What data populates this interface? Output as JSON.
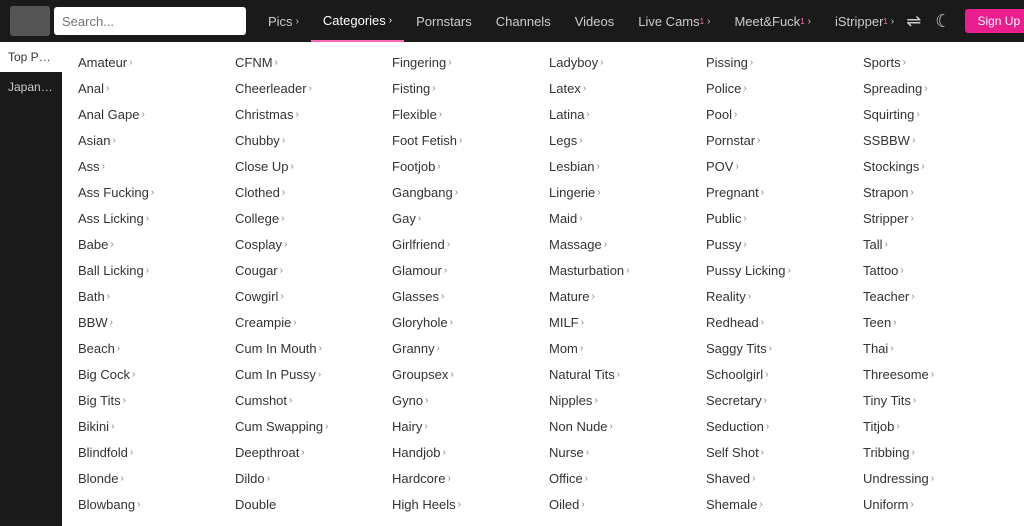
{
  "nav": {
    "items": [
      {
        "label": "Pics",
        "arrow": true,
        "active": false
      },
      {
        "label": "Categories",
        "arrow": true,
        "active": true
      },
      {
        "label": "Pornstars",
        "arrow": false,
        "active": false
      },
      {
        "label": "Channels",
        "arrow": false,
        "active": false
      },
      {
        "label": "Videos",
        "arrow": false,
        "active": false
      },
      {
        "label": "Live Cams",
        "arrow": true,
        "superscript": "1",
        "active": false
      },
      {
        "label": "Meet&Fuck",
        "arrow": true,
        "superscript": "1",
        "active": false
      },
      {
        "label": "iStripper",
        "arrow": true,
        "superscript": "1",
        "active": false
      }
    ],
    "pink_button": "Sign Up"
  },
  "sidebar": {
    "items": [
      {
        "label": "Top Porn"
      },
      {
        "label": "Japanese"
      }
    ]
  },
  "categories": {
    "columns": [
      [
        {
          "label": "Amateur",
          "arrow": true
        },
        {
          "label": "Anal",
          "arrow": true
        },
        {
          "label": "Anal Gape",
          "arrow": true
        },
        {
          "label": "Asian",
          "arrow": true
        },
        {
          "label": "Ass",
          "arrow": true
        },
        {
          "label": "Ass Fucking",
          "arrow": true
        },
        {
          "label": "Ass Licking",
          "arrow": true
        },
        {
          "label": "Babe",
          "arrow": true
        },
        {
          "label": "Ball Licking",
          "arrow": true
        },
        {
          "label": "Bath",
          "arrow": true
        },
        {
          "label": "BBW",
          "arrow": true
        },
        {
          "label": "Beach",
          "arrow": true
        },
        {
          "label": "Big Cock",
          "arrow": true
        },
        {
          "label": "Big Tits",
          "arrow": true
        },
        {
          "label": "Bikini",
          "arrow": true
        },
        {
          "label": "Blindfold",
          "arrow": true
        },
        {
          "label": "Blonde",
          "arrow": true
        },
        {
          "label": "Blowbang",
          "arrow": true
        }
      ],
      [
        {
          "label": "CFNM",
          "arrow": true
        },
        {
          "label": "Cheerleader",
          "arrow": true
        },
        {
          "label": "Christmas",
          "arrow": true
        },
        {
          "label": "Chubby",
          "arrow": true
        },
        {
          "label": "Close Up",
          "arrow": true
        },
        {
          "label": "Clothed",
          "arrow": true
        },
        {
          "label": "College",
          "arrow": true
        },
        {
          "label": "Cosplay",
          "arrow": true
        },
        {
          "label": "Cougar",
          "arrow": true
        },
        {
          "label": "Cowgirl",
          "arrow": true
        },
        {
          "label": "Creampie",
          "arrow": true
        },
        {
          "label": "Cum In Mouth",
          "arrow": true
        },
        {
          "label": "Cum In Pussy",
          "arrow": true
        },
        {
          "label": "Cumshot",
          "arrow": true
        },
        {
          "label": "Cum Swapping",
          "arrow": true
        },
        {
          "label": "Deepthroat",
          "arrow": true
        },
        {
          "label": "Dildo",
          "arrow": true
        },
        {
          "label": "Double",
          "arrow": false
        }
      ],
      [
        {
          "label": "Fingering",
          "arrow": true
        },
        {
          "label": "Fisting",
          "arrow": true
        },
        {
          "label": "Flexible",
          "arrow": true
        },
        {
          "label": "Foot Fetish",
          "arrow": true
        },
        {
          "label": "Footjob",
          "arrow": true
        },
        {
          "label": "Gangbang",
          "arrow": true
        },
        {
          "label": "Gay",
          "arrow": true
        },
        {
          "label": "Girlfriend",
          "arrow": true
        },
        {
          "label": "Glamour",
          "arrow": true
        },
        {
          "label": "Glasses",
          "arrow": true
        },
        {
          "label": "Gloryhole",
          "arrow": true
        },
        {
          "label": "Granny",
          "arrow": true
        },
        {
          "label": "Groupsex",
          "arrow": true
        },
        {
          "label": "Gyno",
          "arrow": true
        },
        {
          "label": "Hairy",
          "arrow": true
        },
        {
          "label": "Handjob",
          "arrow": true
        },
        {
          "label": "Hardcore",
          "arrow": true
        },
        {
          "label": "High Heels",
          "arrow": true
        }
      ],
      [
        {
          "label": "Ladyboy",
          "arrow": true
        },
        {
          "label": "Latex",
          "arrow": true
        },
        {
          "label": "Latina",
          "arrow": true
        },
        {
          "label": "Legs",
          "arrow": true
        },
        {
          "label": "Lesbian",
          "arrow": true
        },
        {
          "label": "Lingerie",
          "arrow": true
        },
        {
          "label": "Maid",
          "arrow": true
        },
        {
          "label": "Massage",
          "arrow": true
        },
        {
          "label": "Masturbation",
          "arrow": true
        },
        {
          "label": "Mature",
          "arrow": true
        },
        {
          "label": "MILF",
          "arrow": true
        },
        {
          "label": "Mom",
          "arrow": true
        },
        {
          "label": "Natural Tits",
          "arrow": true
        },
        {
          "label": "Nipples",
          "arrow": true
        },
        {
          "label": "Non Nude",
          "arrow": true
        },
        {
          "label": "Nurse",
          "arrow": true
        },
        {
          "label": "Office",
          "arrow": true
        },
        {
          "label": "Oiled",
          "arrow": true
        }
      ],
      [
        {
          "label": "Pissing",
          "arrow": true
        },
        {
          "label": "Police",
          "arrow": true
        },
        {
          "label": "Pool",
          "arrow": true
        },
        {
          "label": "Pornstar",
          "arrow": true
        },
        {
          "label": "POV",
          "arrow": true
        },
        {
          "label": "Pregnant",
          "arrow": true
        },
        {
          "label": "Public",
          "arrow": true
        },
        {
          "label": "Pussy",
          "arrow": true
        },
        {
          "label": "Pussy Licking",
          "arrow": true
        },
        {
          "label": "Reality",
          "arrow": true
        },
        {
          "label": "Redhead",
          "arrow": true
        },
        {
          "label": "Saggy Tits",
          "arrow": true
        },
        {
          "label": "Schoolgirl",
          "arrow": true
        },
        {
          "label": "Secretary",
          "arrow": true
        },
        {
          "label": "Seduction",
          "arrow": true
        },
        {
          "label": "Self Shot",
          "arrow": true
        },
        {
          "label": "Shaved",
          "arrow": true
        },
        {
          "label": "Shemale",
          "arrow": true
        }
      ],
      [
        {
          "label": "Sports",
          "arrow": true
        },
        {
          "label": "Spreading",
          "arrow": true
        },
        {
          "label": "Squirting",
          "arrow": true
        },
        {
          "label": "SSBBW",
          "arrow": true
        },
        {
          "label": "Stockings",
          "arrow": true
        },
        {
          "label": "Strapon",
          "arrow": true
        },
        {
          "label": "Stripper",
          "arrow": true
        },
        {
          "label": "Tall",
          "arrow": true
        },
        {
          "label": "Tattoo",
          "arrow": true
        },
        {
          "label": "Teacher",
          "arrow": true
        },
        {
          "label": "Teen",
          "arrow": true
        },
        {
          "label": "Thai",
          "arrow": true
        },
        {
          "label": "Threesome",
          "arrow": true
        },
        {
          "label": "Tiny Tits",
          "arrow": true
        },
        {
          "label": "Titjob",
          "arrow": true
        },
        {
          "label": "Tribbing",
          "arrow": true
        },
        {
          "label": "Undressing",
          "arrow": true
        },
        {
          "label": "Uniform",
          "arrow": true
        }
      ]
    ]
  }
}
